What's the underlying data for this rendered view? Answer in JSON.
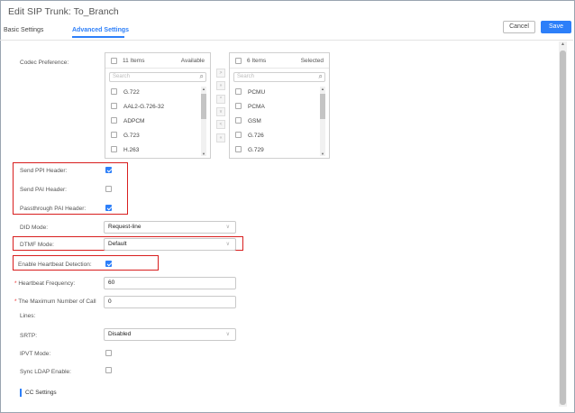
{
  "header": {
    "title": "Edit SIP Trunk: To_Branch",
    "tabs": [
      "Basic Settings",
      "Advanced Settings"
    ],
    "cancel_label": "Cancel",
    "save_label": "Save"
  },
  "codec": {
    "label": "Codec Preference:",
    "available": {
      "count": "11 Items",
      "state": "Available",
      "placeholder": "Search",
      "items": [
        "G.722",
        "AAL2-G.726-32",
        "ADPCM",
        "G.723",
        "H.263"
      ]
    },
    "selected": {
      "count": "6 Items",
      "state": "Selected",
      "placeholder": "Search",
      "items": [
        "PCMU",
        "PCMA",
        "GSM",
        "G.726",
        "G.729"
      ]
    }
  },
  "fields": {
    "send_ppi_label": "Send PPI Header:",
    "send_ppi_checked": true,
    "send_pai_label": "Send PAI Header:",
    "send_pai_checked": false,
    "passthrough_pai_label": "Passthrough PAI Header:",
    "passthrough_pai_checked": true,
    "did_mode_label": "DID Mode:",
    "did_mode_value": "Request-line",
    "dtmf_mode_label": "DTMF Mode:",
    "dtmf_mode_value": "Default",
    "heartbeat_label": "Enable Heartbeat Detection:",
    "heartbeat_checked": true,
    "heartbeat_freq_label": "Heartbeat Frequency:",
    "heartbeat_freq_value": "60",
    "max_calls_label_1": "The Maximum Number of Call",
    "max_calls_label_2": "Lines:",
    "max_calls_value": "0",
    "srtp_label": "SRTP:",
    "srtp_value": "Disabled",
    "ipvt_label": "IPVT Mode:",
    "ipvt_checked": false,
    "ldap_label": "Sync LDAP Enable:",
    "ldap_checked": false,
    "required_mark": "*"
  },
  "section": {
    "cc_title": "CC Settings"
  },
  "colors": {
    "accent": "#2d7ff9",
    "highlight_box": "#d81e1e"
  }
}
